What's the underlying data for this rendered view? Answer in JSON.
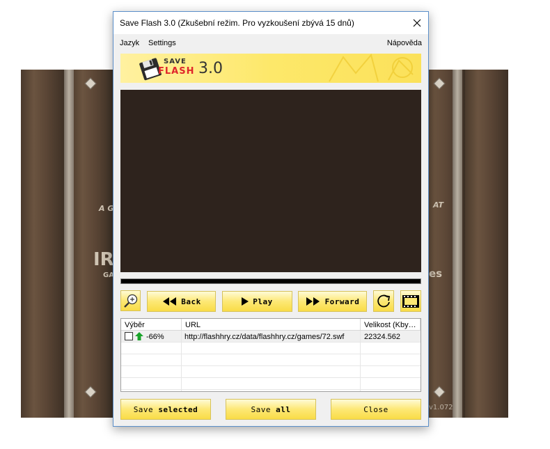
{
  "background": {
    "left_text_a": "A G",
    "left_text_b": "IRO",
    "left_text_c": "GA",
    "right_text_a": "AT",
    "right_text_b": "es",
    "version": "v1.072"
  },
  "window": {
    "title": "Save Flash 3.0 (Zkušební režim. Pro vyzkoušení zbývá 15 dnů)"
  },
  "menu": {
    "items": [
      "Jazyk",
      "Settings"
    ],
    "help": "Nápověda"
  },
  "logo": {
    "save": "SAVE",
    "flash": "FLASH",
    "version": "3.0"
  },
  "player": {
    "progress_fraction": 0.0
  },
  "controls": {
    "back": "Back",
    "play": "Play",
    "forward": "Forward"
  },
  "table": {
    "columns": [
      "Výběr",
      "URL",
      "Velikost (Kby…"
    ],
    "rows": [
      {
        "checked": false,
        "percent": "-66%",
        "url": "http://flashhry.cz/data/flashhry.cz/games/72.swf",
        "size": "22324.562"
      }
    ]
  },
  "footer": {
    "save_selected_a": "Save ",
    "save_selected_b": "selected",
    "save_all_a": "Save ",
    "save_all_b": "all",
    "close": "Close"
  },
  "colors": {
    "button_yellow": "#fde875",
    "game_bg": "#3a2e25",
    "accent_red": "#e0262b"
  }
}
